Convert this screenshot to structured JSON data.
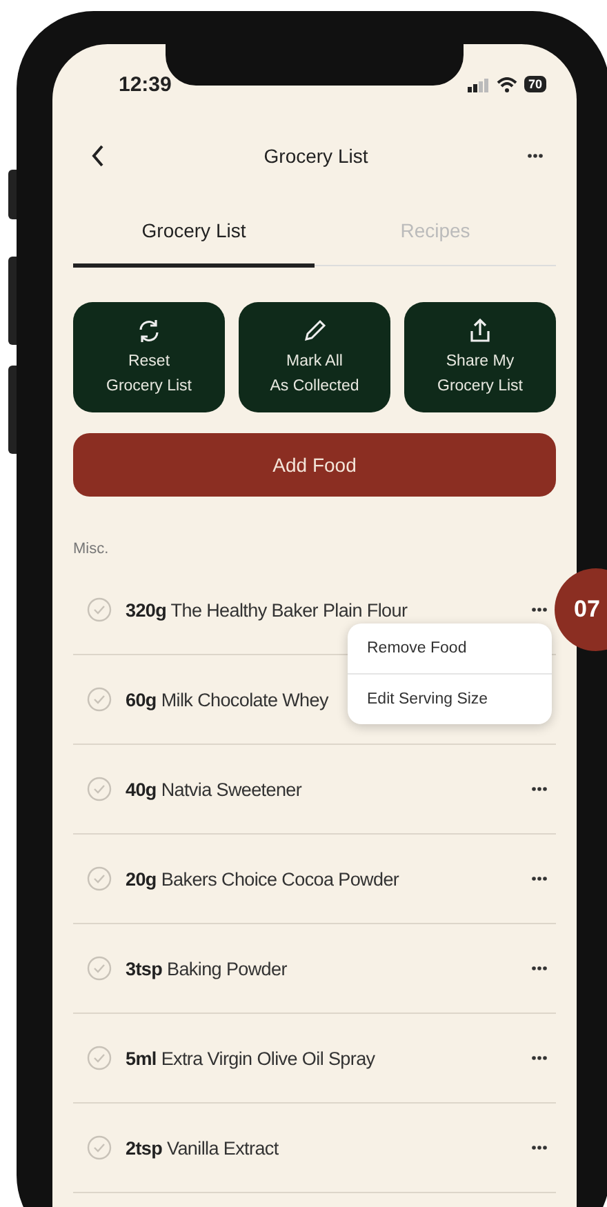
{
  "status_bar": {
    "time": "12:39",
    "battery": "70"
  },
  "header": {
    "title": "Grocery List"
  },
  "tabs": [
    {
      "label": "Grocery List",
      "selected": true
    },
    {
      "label": "Recipes",
      "selected": false
    }
  ],
  "actions": [
    {
      "kind": "reset",
      "lines": [
        "Reset",
        "Grocery List"
      ]
    },
    {
      "kind": "mark",
      "lines": [
        "Mark All",
        "As Collected"
      ]
    },
    {
      "kind": "share",
      "lines": [
        "Share My",
        "Grocery List"
      ]
    }
  ],
  "add_button": "Add Food",
  "section": "Misc.",
  "items": [
    {
      "qty": "320g",
      "name": "The Healthy Baker Plain Flour",
      "checked": false
    },
    {
      "qty": "60g",
      "name": "Milk Chocolate Whey",
      "checked": false
    },
    {
      "qty": "40g",
      "name": "Natvia Sweetener",
      "checked": false
    },
    {
      "qty": "20g",
      "name": "Bakers Choice Cocoa Powder",
      "checked": false
    },
    {
      "qty": "3tsp",
      "name": "Baking Powder",
      "checked": false
    },
    {
      "qty": "5ml",
      "name": "Extra Virgin Olive Oil Spray",
      "checked": false
    },
    {
      "qty": "2tsp",
      "name": "Vanilla Extract",
      "checked": false
    }
  ],
  "context_menu": {
    "items": [
      "Remove Food",
      "Edit Serving Size"
    ]
  },
  "step_badge": "07"
}
